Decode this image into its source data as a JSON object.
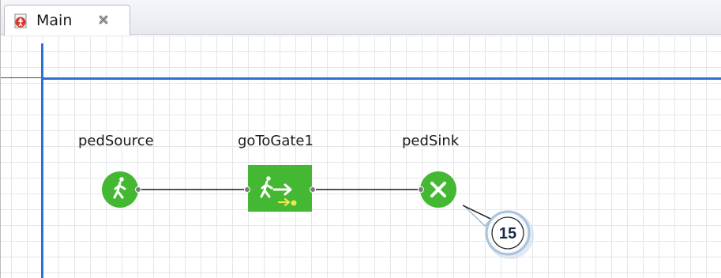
{
  "tab": {
    "label": "Main"
  },
  "blocks": [
    {
      "id": "pedSource",
      "label": "pedSource",
      "type": "source"
    },
    {
      "id": "goToGate1",
      "label": "goToGate1",
      "type": "goto"
    },
    {
      "id": "pedSink",
      "label": "pedSink",
      "type": "sink"
    }
  ],
  "callout": {
    "number": "15"
  },
  "colors": {
    "block_green": "#44b832",
    "origin_blue": "#2f6fd4",
    "callout_ring": "#9bbbd8"
  }
}
